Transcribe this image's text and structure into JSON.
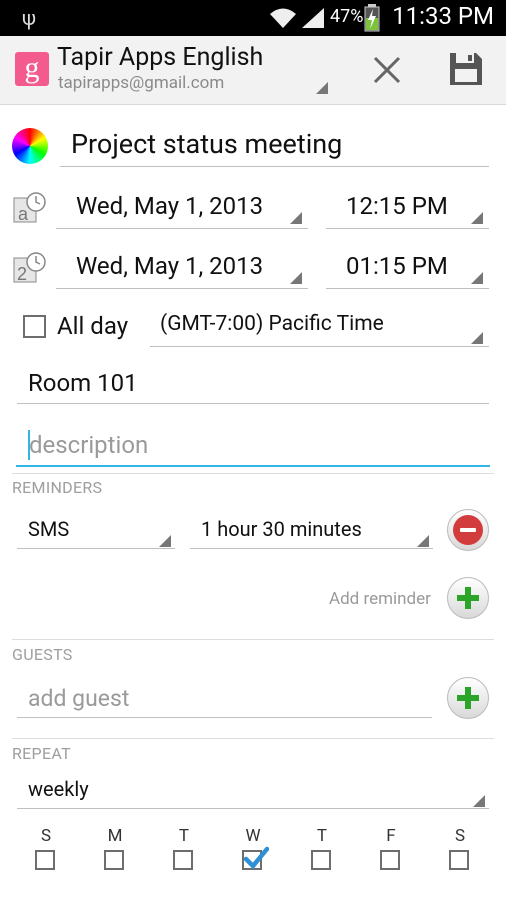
{
  "status_bar": {
    "battery_percent": "47%",
    "time": "11:33 PM"
  },
  "account": {
    "name": "Tapir Apps English",
    "email": "tapirapps@gmail.com",
    "logo_letter": "g"
  },
  "toolbar_icons": {
    "close": "close-icon",
    "save": "save-icon"
  },
  "event": {
    "title": "Project status meeting",
    "start": {
      "date": "Wed, May 1, 2013",
      "time": "12:15 PM"
    },
    "end": {
      "date": "Wed, May 1, 2013",
      "time": "01:15 PM"
    },
    "all_day_label": "All day",
    "all_day_checked": false,
    "timezone": "(GMT-7:00) Pacific Time",
    "location": "Room 101",
    "description_placeholder": "description"
  },
  "reminders": {
    "label": "REMINDERS",
    "items": [
      {
        "method": "SMS",
        "time": "1 hour 30 minutes"
      }
    ],
    "add_label": "Add reminder"
  },
  "guests": {
    "label": "GUESTS",
    "placeholder": "add guest"
  },
  "repeat": {
    "label": "REPEAT",
    "value": "weekly",
    "days": [
      {
        "letter": "S",
        "checked": false
      },
      {
        "letter": "M",
        "checked": false
      },
      {
        "letter": "T",
        "checked": false
      },
      {
        "letter": "W",
        "checked": true
      },
      {
        "letter": "T",
        "checked": false
      },
      {
        "letter": "F",
        "checked": false
      },
      {
        "letter": "S",
        "checked": false
      }
    ]
  },
  "colors": {
    "accent": "#33b5e5",
    "add_green": "#2aa52a",
    "remove_red": "#d23c3c",
    "brand_pink": "#f35b8e"
  }
}
